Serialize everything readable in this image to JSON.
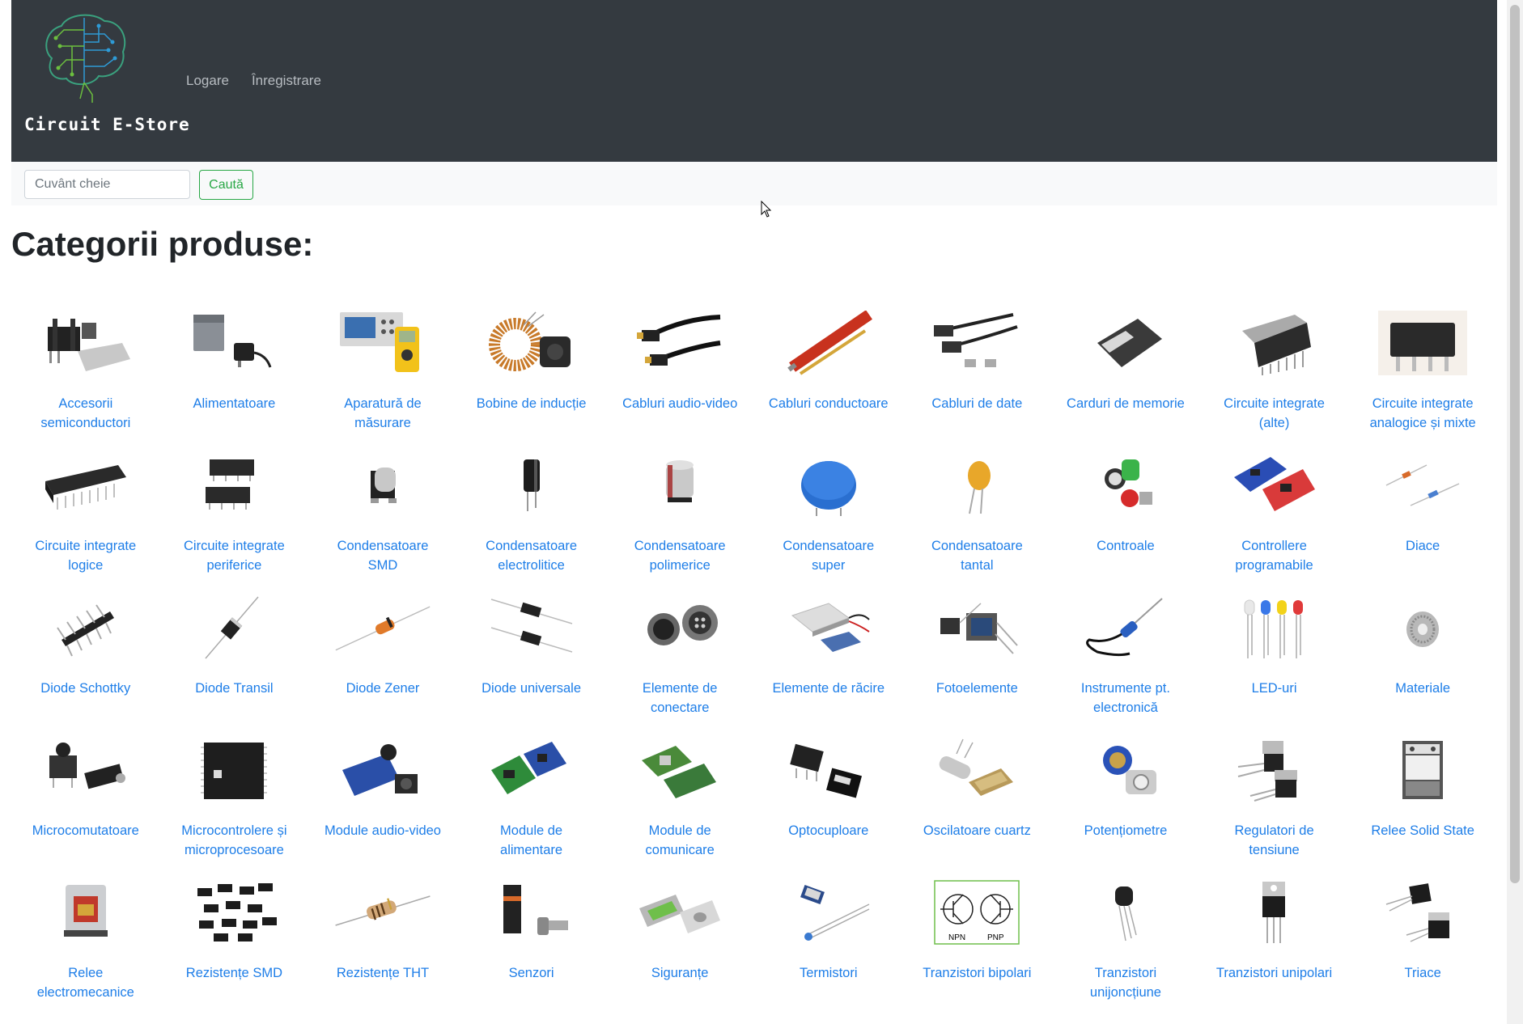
{
  "header": {
    "brand_name": "Circuit E-Store",
    "nav": [
      {
        "label": "Logare"
      },
      {
        "label": "Înregistrare"
      }
    ]
  },
  "search": {
    "placeholder": "Cuvânt cheie",
    "button_label": "Caută"
  },
  "page_title": "Categorii produse:",
  "categories": [
    {
      "label": "Accesorii semiconductori",
      "icon": "heatsink-icon"
    },
    {
      "label": "Alimentatoare",
      "icon": "power-supply-icon"
    },
    {
      "label": "Aparatură de măsurare",
      "icon": "multimeter-icon"
    },
    {
      "label": "Bobine de inducție",
      "icon": "inductor-icon"
    },
    {
      "label": "Cabluri audio-video",
      "icon": "hdmi-cable-icon"
    },
    {
      "label": "Cabluri conductoare",
      "icon": "wire-icon"
    },
    {
      "label": "Cabluri de date",
      "icon": "data-cable-icon"
    },
    {
      "label": "Carduri de memorie",
      "icon": "memory-card-icon"
    },
    {
      "label": "Circuite integrate (alte)",
      "icon": "ic-sip-icon"
    },
    {
      "label": "Circuite integrate analogice și mixte",
      "icon": "ic-dip-icon"
    },
    {
      "label": "Circuite integrate logice",
      "icon": "ic-logic-icon"
    },
    {
      "label": "Circuite integrate periferice",
      "icon": "ic-peripheral-icon"
    },
    {
      "label": "Condensatoare SMD",
      "icon": "smd-capacitor-icon"
    },
    {
      "label": "Condensatoare electrolitice",
      "icon": "electrolytic-capacitor-icon"
    },
    {
      "label": "Condensatoare polimerice",
      "icon": "polymer-capacitor-icon"
    },
    {
      "label": "Condensatoare super",
      "icon": "supercapacitor-icon"
    },
    {
      "label": "Condensatoare tantal",
      "icon": "tantalum-capacitor-icon"
    },
    {
      "label": "Controale",
      "icon": "indicator-light-icon"
    },
    {
      "label": "Controllere programabile",
      "icon": "dev-board-icon"
    },
    {
      "label": "Diace",
      "icon": "diac-icon"
    },
    {
      "label": "Diode Schottky",
      "icon": "pin-header-icon"
    },
    {
      "label": "Diode Transil",
      "icon": "transil-diode-icon"
    },
    {
      "label": "Diode Zener",
      "icon": "zener-diode-icon"
    },
    {
      "label": "Diode universale",
      "icon": "diode-icon"
    },
    {
      "label": "Elemente de conectare",
      "icon": "connector-icon"
    },
    {
      "label": "Elemente de răcire",
      "icon": "peltier-icon"
    },
    {
      "label": "Fotoelemente",
      "icon": "photo-sensor-icon"
    },
    {
      "label": "Instrumente pt. electronică",
      "icon": "soldering-iron-icon"
    },
    {
      "label": "LED-uri",
      "icon": "led-icon"
    },
    {
      "label": "Materiale",
      "icon": "solder-spool-icon"
    },
    {
      "label": "Microcomutatoare",
      "icon": "microswitch-icon"
    },
    {
      "label": "Microcontrolere și microprocesoare",
      "icon": "microcontroller-icon"
    },
    {
      "label": "Module audio-video",
      "icon": "av-module-icon"
    },
    {
      "label": "Module de alimentare",
      "icon": "power-module-icon"
    },
    {
      "label": "Module de comunicare",
      "icon": "comm-module-icon"
    },
    {
      "label": "Optocuploare",
      "icon": "optocoupler-icon"
    },
    {
      "label": "Oscilatoare cuartz",
      "icon": "crystal-icon"
    },
    {
      "label": "Potențiometre",
      "icon": "potentiometer-icon"
    },
    {
      "label": "Regulatori de tensiune",
      "icon": "voltage-regulator-icon"
    },
    {
      "label": "Relee Solid State",
      "icon": "ssr-icon"
    },
    {
      "label": "Relee electromecanice",
      "icon": "relay-icon"
    },
    {
      "label": "Rezistențe SMD",
      "icon": "smd-resistor-icon"
    },
    {
      "label": "Rezistențe THT",
      "icon": "resistor-icon"
    },
    {
      "label": "Senzori",
      "icon": "sensor-icon"
    },
    {
      "label": "Siguranțe",
      "icon": "fuse-icon"
    },
    {
      "label": "Termistori",
      "icon": "thermistor-icon"
    },
    {
      "label": "Tranzistori bipolari",
      "icon": "bjt-symbol-icon"
    },
    {
      "label": "Tranzistori unijoncțiune",
      "icon": "to92-transistor-icon"
    },
    {
      "label": "Tranzistori unipolari",
      "icon": "to220-transistor-icon"
    },
    {
      "label": "Triace",
      "icon": "triac-icon"
    }
  ],
  "colors": {
    "navbar_bg": "#343a40",
    "link": "#1e7ee8",
    "search_button": "#28a745",
    "searchbar_bg": "#f8f9fa"
  }
}
